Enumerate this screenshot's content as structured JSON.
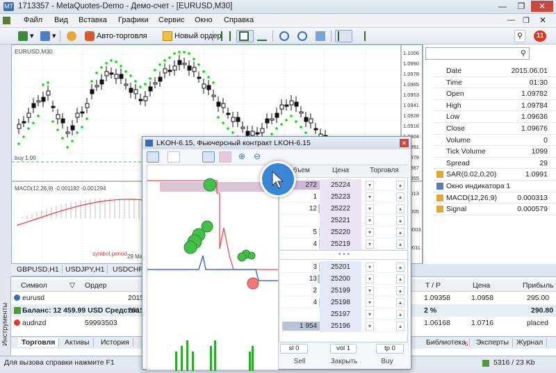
{
  "window": {
    "title": "1713357 - MetaQuotes-Demo - Демо-счет - [EURUSD,M30]"
  },
  "menu": [
    "Файл",
    "Вид",
    "Вставка",
    "Графики",
    "Сервис",
    "Окно",
    "Справка"
  ],
  "toolbar": {
    "auto_trading": "Авто-торговля",
    "new_order": "Новый ордер",
    "badge": "11"
  },
  "chart": {
    "symbol_label": "EURUSD,M30",
    "buy_label": "buy 1.00",
    "macd_label": "MACD(12,26,9) -0.001182 -0.001294",
    "symbol_period_tag": "symbol,period",
    "date_label": "29 May",
    "price_ticks": [
      "1.1006",
      "1.0990",
      "1.0978",
      "1.0965",
      "1.0953",
      "1.0941",
      "1.0928",
      "1.0916",
      "1.0904",
      "1.0891",
      "1.0879",
      "1.0867",
      "1.0855"
    ],
    "macd_ticks": [
      "0.0013",
      "0.0005",
      "-0.0003",
      "-0.0011"
    ]
  },
  "chart_tabs": [
    "GBPUSD,H1",
    "USDJPY,H1",
    "USDCHF,"
  ],
  "data_window": {
    "rows": [
      {
        "k": "Date",
        "v": "2015.06.01"
      },
      {
        "k": "Time",
        "v": "01:30"
      },
      {
        "k": "Open",
        "v": "1.09782"
      },
      {
        "k": "High",
        "v": "1.09784"
      },
      {
        "k": "Low",
        "v": "1.09636"
      },
      {
        "k": "Close",
        "v": "1.09676"
      },
      {
        "k": "Volume",
        "v": "0"
      },
      {
        "k": "Tick Volume",
        "v": "1099"
      },
      {
        "k": "Spread",
        "v": "29"
      },
      {
        "k": "SAR(0.02,0.20)",
        "v": "1.0991"
      },
      {
        "k": "Окно индикатора 1",
        "v": ""
      },
      {
        "k": "MACD(12,26,9)",
        "v": "0.000313"
      },
      {
        "k": "Signal",
        "v": "0.000579"
      }
    ]
  },
  "dom": {
    "title": "LKOH-6.15, Фьючерсный контракт LKOH-6.15",
    "headers": {
      "volume": "Объем",
      "price": "Цена",
      "trade": "Торговля"
    },
    "sell_rows": [
      {
        "vol": "272",
        "price": "25224"
      },
      {
        "vol": "1",
        "price": "25223"
      },
      {
        "vol": "12",
        "price": "25222"
      },
      {
        "vol": "",
        "price": "25221"
      },
      {
        "vol": "5",
        "price": "25220"
      },
      {
        "vol": "4",
        "price": "25219"
      }
    ],
    "dots": "• • •",
    "buy_rows": [
      {
        "vol": "3",
        "price": "25201"
      },
      {
        "vol": "13",
        "price": "25200"
      },
      {
        "vol": "2",
        "price": "25199"
      },
      {
        "vol": "4",
        "price": "25198"
      },
      {
        "vol": "",
        "price": "25197"
      },
      {
        "vol": "1 954",
        "price": "25196"
      }
    ],
    "sl_value": "sl 0",
    "vol_value": "vol 1",
    "tp_value": "tp 0",
    "sell_label": "Sell",
    "close_label": "Закрыть",
    "buy_label": "Buy"
  },
  "toolbox": {
    "side_label": "Инструменты",
    "columns": {
      "symbol": "Символ",
      "order": "Ордер",
      "tp": "T / P",
      "price": "Цена",
      "profit": "Прибыль"
    },
    "rows": [
      {
        "symbol": "eurusd",
        "order": "2015",
        "tp": "1.09358",
        "price": "1.0958",
        "profit": "295.00"
      },
      {
        "symbol": "Баланс: 12 459.99 USD  Средства:",
        "order": "2015",
        "tp": "2 %",
        "price": "",
        "profit": "290.80"
      },
      {
        "symbol": "audnzd",
        "order": "59993503",
        "tp": "1.06168",
        "price": "1.0716",
        "profit": "placed"
      }
    ],
    "tabs": [
      "Торговля",
      "Активы",
      "История",
      "Библиотека",
      "Эксперты",
      "Журнал"
    ],
    "library_badge": "5"
  },
  "status": {
    "help": "Для вызова справки нажмите F1",
    "traffic": "5316 / 23 Kb"
  },
  "colors": {
    "sar": "#00dd00",
    "macd_line": "#e53333",
    "accent": "#3a86d6"
  }
}
